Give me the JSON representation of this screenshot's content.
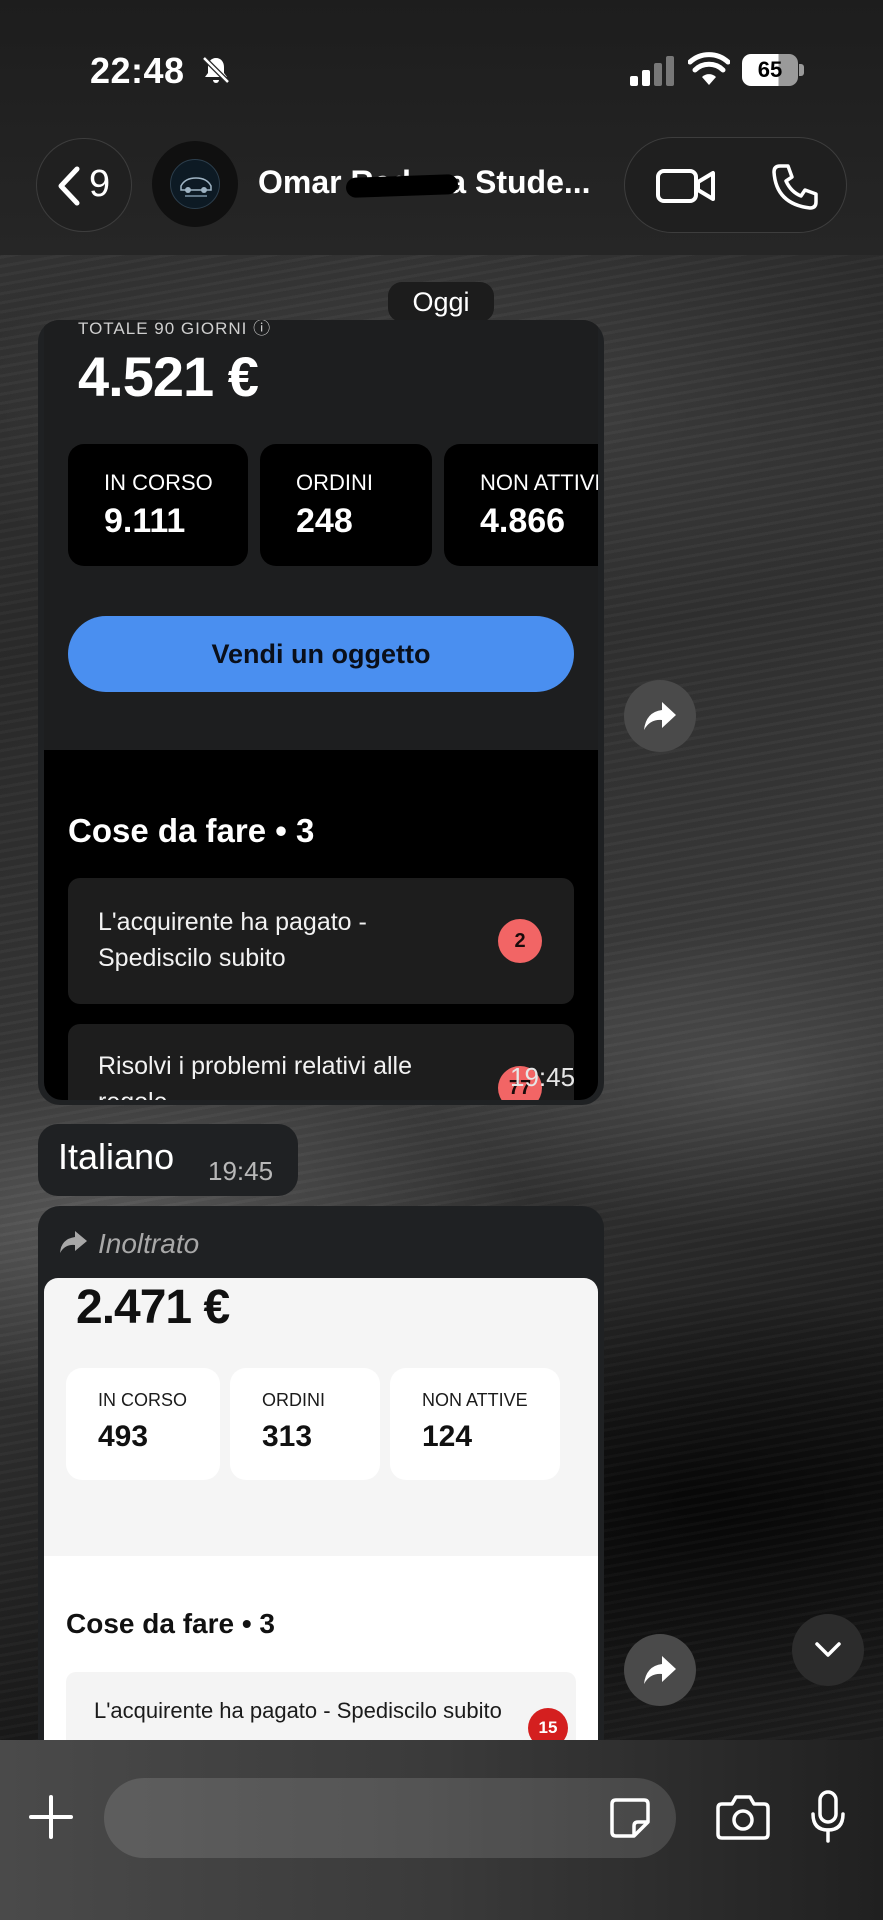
{
  "status_bar": {
    "time": "22:48",
    "battery": "65"
  },
  "header": {
    "back_count": "9",
    "contact_name": "Omar Redana Stude..."
  },
  "chat": {
    "date_chip": "Oggi",
    "message1": {
      "cut_label": "TOTALE 90 GIORNI ⓘ",
      "total": "4.521 €",
      "stats": [
        {
          "label": "IN CORSO",
          "value": "9.111"
        },
        {
          "label": "ORDINI",
          "value": "248"
        },
        {
          "label": "NON ATTIVE",
          "value": "4.866"
        }
      ],
      "cta": "Vendi un oggetto",
      "todo_title": "Cose da fare • 3",
      "todos": [
        {
          "text": "L'acquirente ha pagato - Spediscilo subito",
          "badge": "2"
        },
        {
          "text": "Risolvi i problemi relativi alle regole",
          "badge": "77"
        }
      ],
      "time": "19:45"
    },
    "message2": {
      "text": "Italiano",
      "time": "19:45"
    },
    "message3": {
      "forward_label": "Inoltrato",
      "total": "2.471 €",
      "stats": [
        {
          "label": "IN CORSO",
          "value": "493"
        },
        {
          "label": "ORDINI",
          "value": "313"
        },
        {
          "label": "NON ATTIVE",
          "value": "124"
        }
      ],
      "todo_title": "Cose da fare • 3",
      "todos": [
        {
          "text": "L'acquirente ha pagato - Spediscilo subito",
          "badge": "15"
        }
      ]
    }
  },
  "composer": {
    "placeholder": ""
  },
  "colors": {
    "accent_blue": "#4a8ff0",
    "badge_red": "#f26565",
    "badge_dark_red": "#d41f1f",
    "bubble": "#1f2123"
  }
}
